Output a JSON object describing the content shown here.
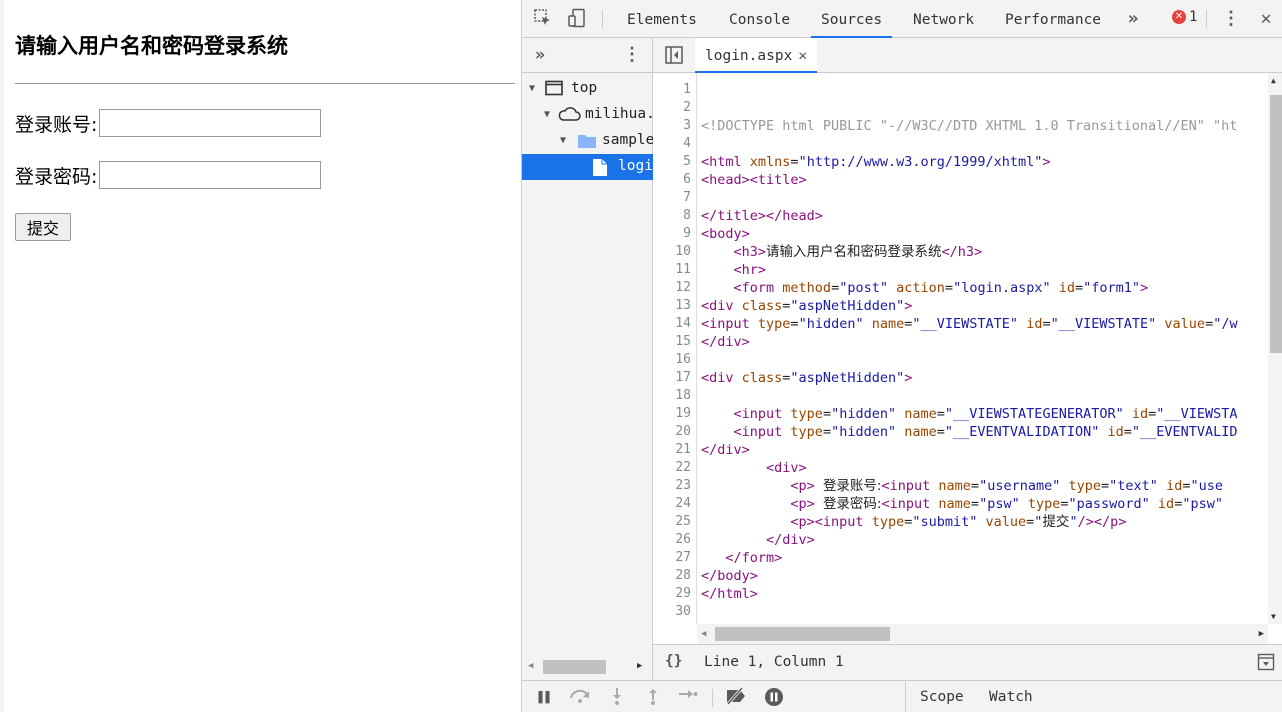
{
  "page": {
    "heading": "请输入用户名和密码登录系统",
    "username_label": "登录账号:",
    "password_label": "登录密码:",
    "submit_label": "提交"
  },
  "devtools": {
    "tabs": [
      "Elements",
      "Console",
      "Sources",
      "Network",
      "Performance"
    ],
    "active_tab": "Sources",
    "more_tabs_icon": "»",
    "error_count": "1",
    "navigator": {
      "items": [
        {
          "label": "top",
          "icon": "frame-icon"
        },
        {
          "label": "milihua.",
          "icon": "cloud-icon"
        },
        {
          "label": "sample",
          "icon": "folder-icon"
        },
        {
          "label": "login",
          "icon": "file-icon"
        }
      ]
    },
    "editor": {
      "file_tab": "login.aspx",
      "line_numbers": [
        "1",
        "2",
        "3",
        "4",
        "5",
        "6",
        "7",
        "8",
        "9",
        "10",
        "11",
        "12",
        "13",
        "14",
        "15",
        "16",
        "17",
        "18",
        "19",
        "20",
        "21",
        "22",
        "23",
        "24",
        "25",
        "26",
        "27",
        "28",
        "29",
        "30"
      ],
      "status": "Line 1, Column 1",
      "format_icon": "{}"
    },
    "debugger": {
      "side_tabs": [
        "Scope",
        "Watch"
      ]
    },
    "colors": {
      "accent": "#1a73e8",
      "tag": "#881280",
      "attr": "#994500",
      "value": "#1a1aa6",
      "error": "#e8403a"
    }
  }
}
